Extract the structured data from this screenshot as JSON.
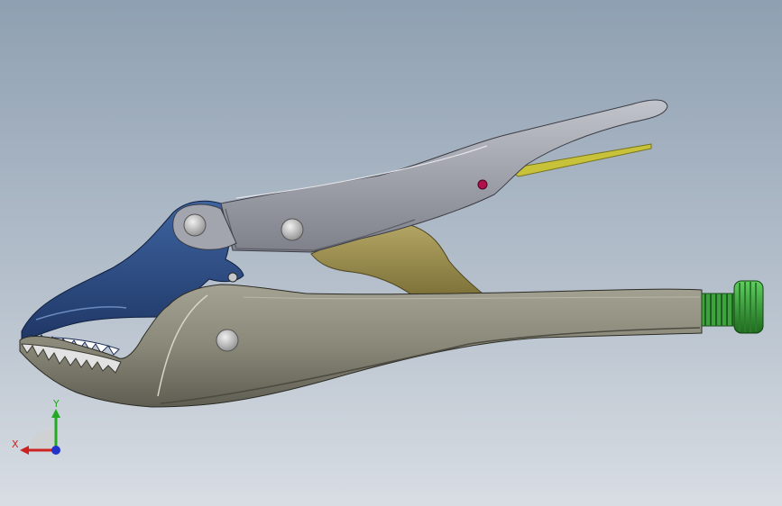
{
  "viewport": {
    "background_top": "#8fa0b2",
    "background_bottom": "#d8dde3"
  },
  "model": {
    "parts": [
      {
        "name": "upper-handle",
        "color": "#9a9ca6"
      },
      {
        "name": "fixed-jaw-handle",
        "color": "#8a8878"
      },
      {
        "name": "movable-jaw",
        "color": "#2e4f85"
      },
      {
        "name": "release-lever",
        "color": "#9a8c4e"
      },
      {
        "name": "spring",
        "color": "#c8c23a"
      },
      {
        "name": "adjust-screw",
        "color": "#3a9a3a"
      }
    ]
  },
  "triad": {
    "x_label": "X",
    "y_label": "Y",
    "x_color": "#cc2222",
    "y_color": "#22aa22",
    "z_color": "#2233cc"
  }
}
